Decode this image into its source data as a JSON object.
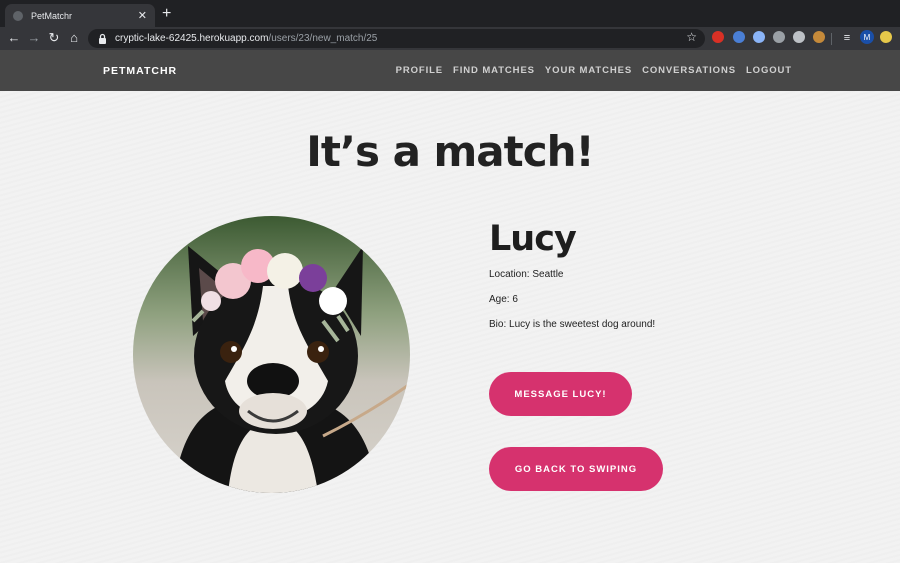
{
  "browser": {
    "tab_title": "PetMatchr",
    "tab_close": "✕",
    "new_tab": "+",
    "url_host": "cryptic-lake-62425.herokuapp.com",
    "url_path": "/users/23/new_match/25",
    "avatar_letter": "M",
    "icons": [
      "back-icon",
      "forward-icon",
      "reload-icon",
      "home-icon",
      "lock-icon",
      "star-icon"
    ]
  },
  "site": {
    "brand": "PETMATCHR",
    "nav": [
      "PROFILE",
      "FIND MATCHES",
      "YOUR MATCHES",
      "CONVERSATIONS",
      "LOGOUT"
    ]
  },
  "match": {
    "headline": "It’s a match!",
    "name": "Lucy",
    "location": "Location: Seattle",
    "age": "Age: 6",
    "bio": "Bio: Lucy is the sweetest dog around!",
    "message_button": "MESSAGE LUCY!",
    "back_button": "GO BACK TO SWIPING"
  },
  "colors": {
    "accent": "#d6326e",
    "nav_bg": "#474747",
    "page_bg": "#f2f2f2"
  }
}
